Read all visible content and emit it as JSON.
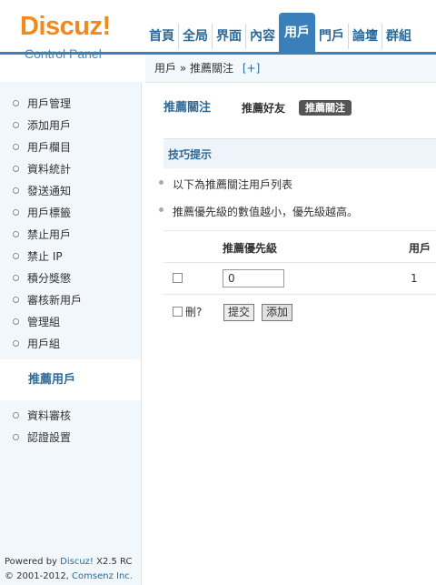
{
  "logo": {
    "brand": "Discuz!",
    "subtitle": "Control Panel"
  },
  "topnav": {
    "tabs": [
      "首頁",
      "全局",
      "界面",
      "內容",
      "用戶",
      "門戶",
      "論壇",
      "群組"
    ],
    "active_index": 4
  },
  "breadcrumb": {
    "section": "用戶",
    "separator": "»",
    "page": "推薦關注",
    "add": "[+]"
  },
  "sidebar": {
    "items": [
      "用戶管理",
      "添加用戶",
      "用戶欄目",
      "資料統計",
      "發送通知",
      "用戶標籤",
      "禁止用戶",
      "禁止 IP",
      "積分獎懲",
      "審核新用戶",
      "管理組",
      "用戶組"
    ],
    "active": "推薦用戶",
    "items_after": [
      "資料審核",
      "認證設置"
    ]
  },
  "footer": {
    "line1_prefix": "Powered by ",
    "line1_link": "Discuz!",
    "line1_suffix": " X2.5 RC",
    "line2_prefix": "© 2001-2012, ",
    "line2_link": "Comsenz Inc."
  },
  "tabs": {
    "primary": "推薦關注",
    "secondary": "推薦好友",
    "badge": "推薦關注"
  },
  "tips": {
    "title": "技巧提示",
    "items": [
      "以下為推薦關注用戶列表",
      "推薦優先級的數值越小，優先級越高。"
    ]
  },
  "table": {
    "columns": [
      "推薦優先級",
      "用戶"
    ],
    "rows": [
      {
        "priority": "0",
        "user": "1"
      }
    ]
  },
  "actions": {
    "delete_label": "刪?",
    "submit_label": "提交",
    "add_label": "添加"
  }
}
